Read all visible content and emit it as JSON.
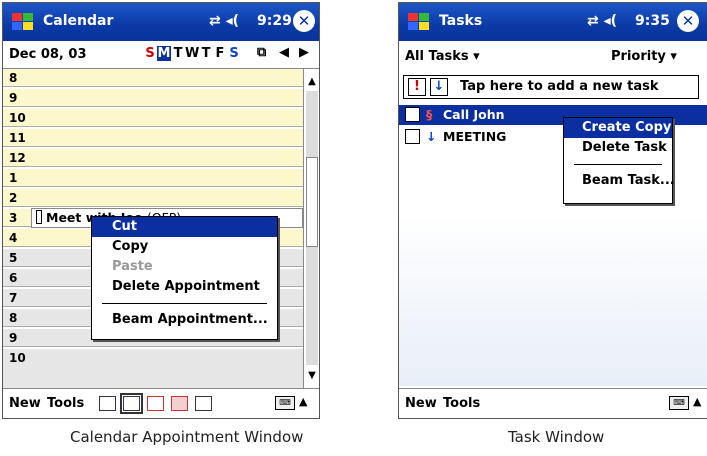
{
  "calendar": {
    "title": "Calendar",
    "time": "9:29",
    "status_icons": "⇄ ◂(",
    "ok": "✕",
    "date": "Dec 08, 03",
    "days": [
      "S",
      "M",
      "T",
      "W",
      "T",
      "F",
      "S"
    ],
    "hours": [
      "8",
      "9",
      "10",
      "11",
      "12",
      "1",
      "2",
      "3",
      "4",
      "5",
      "6",
      "7",
      "8",
      "9",
      "10"
    ],
    "appointment": {
      "title": "Meet with Joe",
      "location": "(OFP)"
    },
    "menu_new": "New",
    "menu_tools": "Tools",
    "context_menu": [
      {
        "label": "Cut",
        "state": "highlighted"
      },
      {
        "label": "Copy",
        "state": "enabled"
      },
      {
        "label": "Paste",
        "state": "disabled"
      },
      {
        "label": "Delete Appointment",
        "state": "enabled"
      },
      {
        "label": "Beam Appointment...",
        "state": "enabled"
      }
    ],
    "caption": "Calendar Appointment Window"
  },
  "tasks": {
    "title": "Tasks",
    "time": "9:35",
    "status_icons": "⇄ ◂(",
    "ok": "✕",
    "filter": "All Tasks ▾",
    "sort": "Priority ▾",
    "add_placeholder": "Tap here to add a new task",
    "priority_high": "!",
    "priority_low": "↓",
    "items": [
      {
        "icon": "§",
        "name": "Call John",
        "selected": true
      },
      {
        "icon": "↓",
        "name": "MEETING",
        "selected": false
      }
    ],
    "menu_new": "New",
    "menu_tools": "Tools",
    "context_menu": [
      {
        "label": "Create Copy",
        "state": "highlighted"
      },
      {
        "label": "Delete Task",
        "state": "enabled"
      },
      {
        "label": "Beam Task...",
        "state": "enabled"
      }
    ],
    "caption": "Task Window"
  },
  "colors": {
    "titlebar": "#0b3aa6",
    "highlight": "#0b2fa0",
    "workday": "#fdf8cc",
    "offhours": "#e6e6e6",
    "sunday": "#d00000",
    "saturday": "#1046c6"
  }
}
